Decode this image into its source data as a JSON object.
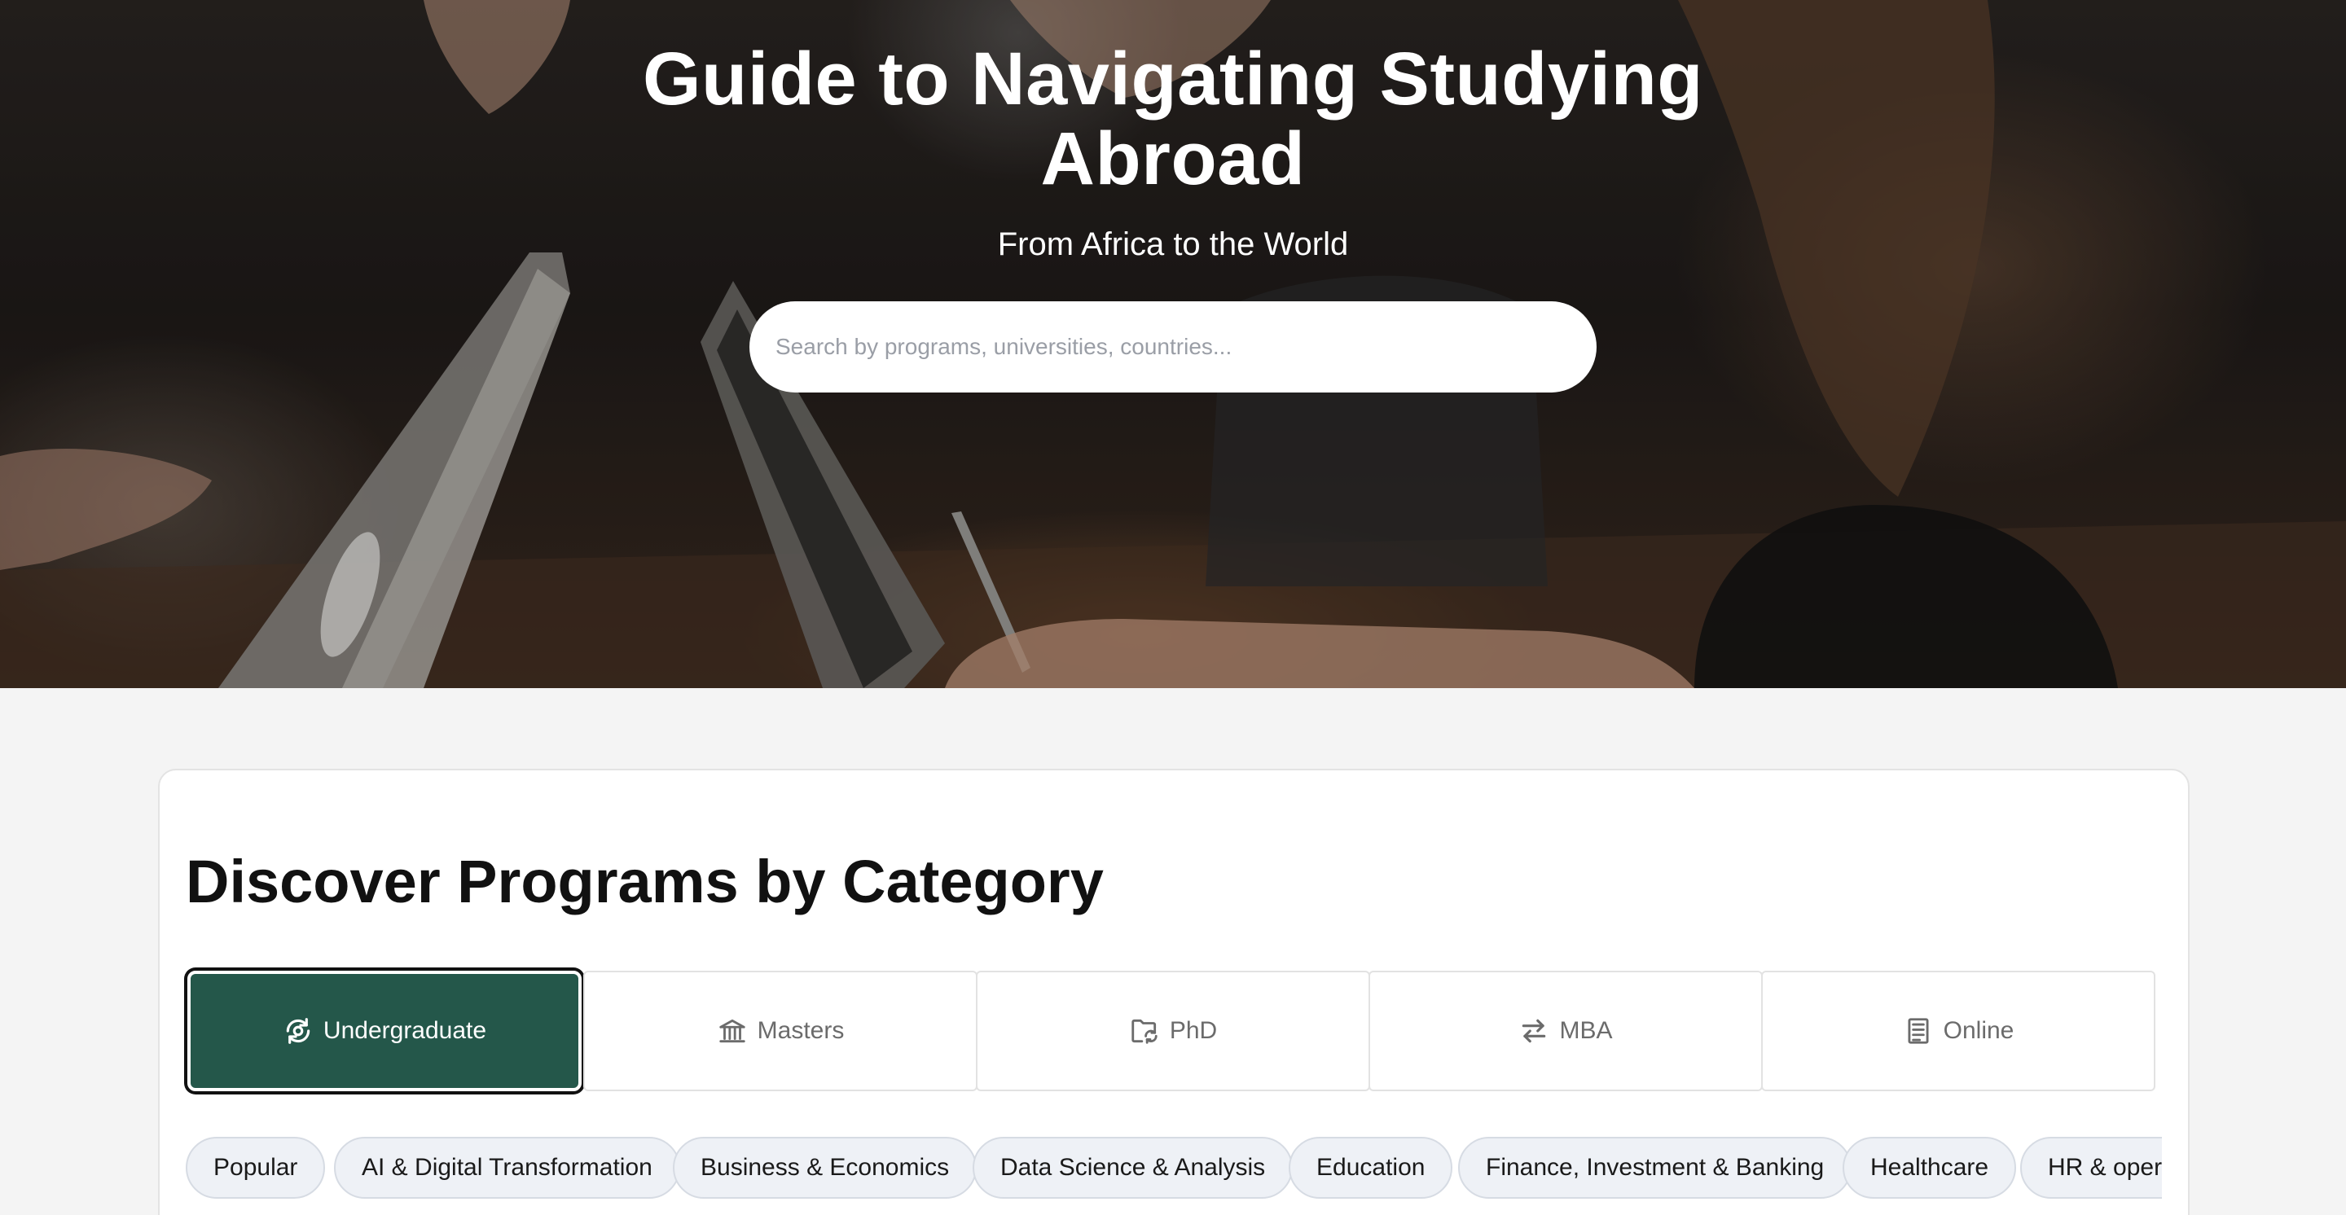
{
  "hero": {
    "title": "Guide to Navigating Studying Abroad",
    "subtitle": "From Africa to the World",
    "search_placeholder": "Search by programs, universities, countries..."
  },
  "categories": {
    "title": "Discover Programs by Category",
    "tabs": [
      {
        "label": "Undergraduate",
        "icon": "refresh-icon",
        "active": true
      },
      {
        "label": "Masters",
        "icon": "bank-icon",
        "active": false
      },
      {
        "label": "PhD",
        "icon": "folder-sync-icon",
        "active": false
      },
      {
        "label": "MBA",
        "icon": "arrows-exchange-icon",
        "active": false
      },
      {
        "label": "Online",
        "icon": "document-icon",
        "active": false
      }
    ],
    "chips": [
      "Popular",
      "AI & Digital Transformation",
      "Business & Economics",
      "Data Science & Analysis",
      "Education",
      "Finance, Investment & Banking",
      "Healthcare",
      "HR & operations"
    ]
  },
  "colors": {
    "accent": "#24574a",
    "chip_bg": "#eef1f6"
  }
}
